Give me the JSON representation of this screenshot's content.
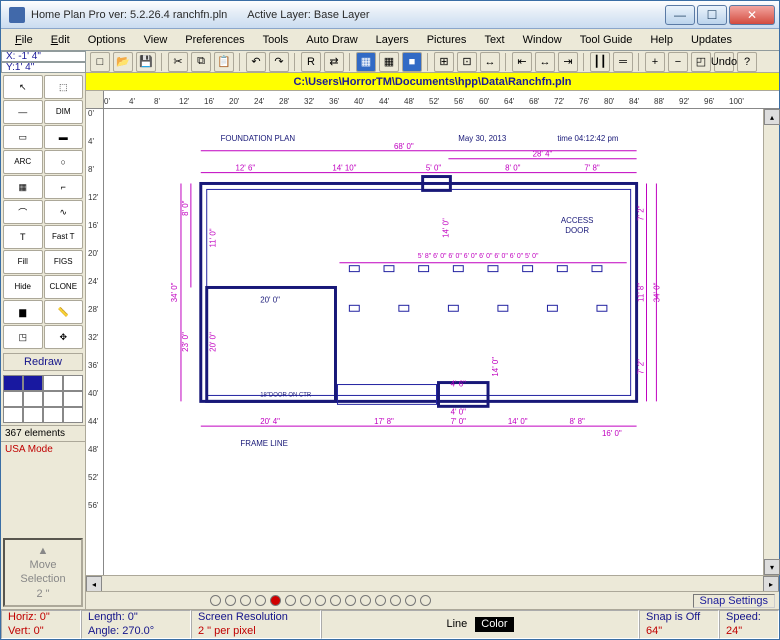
{
  "window": {
    "title1": "Home Plan Pro ver: 5.2.26.4   ranchfn.pln",
    "title2": "Active Layer: Base Layer"
  },
  "menu": {
    "file": "File",
    "edit": "Edit",
    "options": "Options",
    "view": "View",
    "prefs": "Preferences",
    "tools": "Tools",
    "auto": "Auto Draw",
    "layers": "Layers",
    "pictures": "Pictures",
    "text": "Text",
    "window": "Window",
    "guide": "Tool Guide",
    "help": "Help",
    "updates": "Updates"
  },
  "coords": {
    "x": "X: -1' 4\"",
    "y": "Y:1' 4\""
  },
  "path": "C:\\Users\\HorrorTM\\Documents\\hpp\\Data\\Ranchfn.pln",
  "ruler_h": [
    "0'",
    "4'",
    "8'",
    "12'",
    "16'",
    "20'",
    "24'",
    "28'",
    "32'",
    "36'",
    "40'",
    "44'",
    "48'",
    "52'",
    "56'",
    "60'",
    "64'",
    "68'",
    "72'",
    "76'",
    "80'",
    "84'",
    "88'",
    "92'",
    "96'",
    "100'"
  ],
  "ruler_v": [
    "0'",
    "4'",
    "8'",
    "12'",
    "16'",
    "20'",
    "24'",
    "28'",
    "32'",
    "36'",
    "40'",
    "44'",
    "48'",
    "52'",
    "56'"
  ],
  "left": {
    "redraw": "Redraw",
    "elements": "367 elements",
    "usa": "USA Mode",
    "move": "Move\nSelection\n2 \""
  },
  "tools": [
    {
      "n": "select-arrow",
      "t": "↖"
    },
    {
      "n": "area-select",
      "t": "⬚"
    },
    {
      "n": "line",
      "t": "—"
    },
    {
      "n": "dimension",
      "t": "DIM"
    },
    {
      "n": "rect",
      "t": "▭"
    },
    {
      "n": "rect-fill",
      "t": "▬"
    },
    {
      "n": "arc",
      "t": "ARC"
    },
    {
      "n": "circle",
      "t": "○"
    },
    {
      "n": "wall",
      "t": "▦"
    },
    {
      "n": "door",
      "t": "⌐"
    },
    {
      "n": "polyline",
      "t": "⌒"
    },
    {
      "n": "curve",
      "t": "∿"
    },
    {
      "n": "text",
      "t": "T"
    },
    {
      "n": "fast-text",
      "t": "Fast T"
    },
    {
      "n": "fill",
      "t": "Fill"
    },
    {
      "n": "figs",
      "t": "FIGS"
    },
    {
      "n": "hide",
      "t": "Hide"
    },
    {
      "n": "clone",
      "t": "CLONE"
    },
    {
      "n": "color",
      "t": "▆"
    },
    {
      "n": "measure",
      "t": "📏"
    },
    {
      "n": "zoom-fit",
      "t": "◳"
    },
    {
      "n": "pan",
      "t": "✥"
    }
  ],
  "palette": [
    "#1818a0",
    "#1818a0",
    "#ffffff",
    "#ffffff",
    "#ffffff",
    "#ffffff",
    "#ffffff",
    "#ffffff",
    "#ffffff",
    "#ffffff",
    "#ffffff",
    "#ffffff"
  ],
  "toolbar": [
    {
      "n": "new",
      "t": "□"
    },
    {
      "n": "open",
      "t": "📂"
    },
    {
      "n": "save",
      "t": "💾"
    },
    {
      "n": "sep"
    },
    {
      "n": "cut",
      "t": "✂"
    },
    {
      "n": "copy",
      "t": "⧉"
    },
    {
      "n": "paste",
      "t": "📋"
    },
    {
      "n": "sep"
    },
    {
      "n": "undo",
      "t": "↶"
    },
    {
      "n": "redo",
      "t": "↷"
    },
    {
      "n": "sep"
    },
    {
      "n": "rotate",
      "t": "R"
    },
    {
      "n": "mirror",
      "t": "⇄"
    },
    {
      "n": "sep"
    },
    {
      "n": "layer-a",
      "t": "▦",
      "on": true
    },
    {
      "n": "layer-b",
      "t": "▦"
    },
    {
      "n": "layer-c",
      "t": "■",
      "on": true
    },
    {
      "n": "sep"
    },
    {
      "n": "grid",
      "t": "⊞"
    },
    {
      "n": "snap",
      "t": "⊡"
    },
    {
      "n": "measure2",
      "t": "↔"
    },
    {
      "n": "sep"
    },
    {
      "n": "align-l",
      "t": "⇤"
    },
    {
      "n": "align-c",
      "t": "↔"
    },
    {
      "n": "align-r",
      "t": "⇥"
    },
    {
      "n": "sep"
    },
    {
      "n": "dist-h",
      "t": "┃┃"
    },
    {
      "n": "dist-v",
      "t": "═"
    },
    {
      "n": "sep"
    },
    {
      "n": "zoom-in",
      "t": "+"
    },
    {
      "n": "zoom-out",
      "t": "−"
    },
    {
      "n": "zoom-win",
      "t": "◰"
    },
    {
      "n": "undo2",
      "t": "Undo"
    },
    {
      "n": "help2",
      "t": "?"
    }
  ],
  "plan": {
    "title": "FOUNDATION PLAN",
    "date": "May 30, 2013",
    "time": "time 04:12:42 pm",
    "access": "ACCESS",
    "door": "DOOR",
    "dims": {
      "top_total": "68' 0\"",
      "top_right": "28' 4\"",
      "t1": "12' 6\"",
      "t2": "14' 10\"",
      "t3": "5' 0\"",
      "t4": "8' 0\"",
      "t5": "7' 8\"",
      "l1": "8' 0\"",
      "l2": "11' 0\"",
      "l3": "34' 0\"",
      "l4": "20' 0\"",
      "l5": "23' 0\"",
      "mid": "5' 8\"  6' 0\"  6' 0\"  6' 0\"  6' 0\"  6' 0\"  6' 0\"  5' 0\"",
      "g": "20' 0\"",
      "r1": "14' 0\"",
      "r2": "7' 2\"",
      "r3": "11' 8\"",
      "r4": "7' 2\"",
      "r5": "34' 0\"",
      "b1": "20' 4\"",
      "b2": "17' 8\"",
      "b3": "7' 0\"",
      "b4": "14' 0\"",
      "b5": "8' 8\"",
      "b6": "16' 0\"",
      "bl1": "4' 0\"",
      "bl2": "4' 6\"",
      "bl3": "14' 0\"",
      "fl": "FRAME LINE",
      "dc": "18\"DOOR ON CTR"
    }
  },
  "snap": {
    "label": "Snap Settings"
  },
  "status": {
    "horiz": "Horiz: 0\"",
    "vert": "Vert:  0\"",
    "length": "Length:  0\"",
    "angle": "Angle: 270.0°",
    "res1": "Screen Resolution",
    "res2": "2 \" per pixel",
    "line": "Line",
    "color": "Color",
    "snap1": "Snap is Off",
    "snap2": "64\"",
    "speed1": "Speed:",
    "speed2": "24\""
  }
}
